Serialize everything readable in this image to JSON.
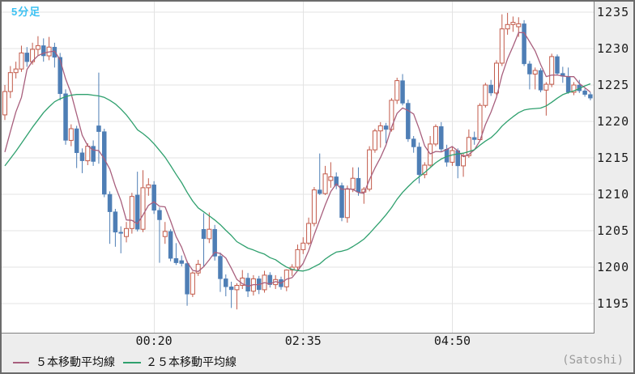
{
  "title": "5分足",
  "unit_label": "(Satoshi)",
  "colors": {
    "up": "#c25a4a",
    "down": "#4e7eb5",
    "ma5": "#a85f7d",
    "ma25": "#2fa06e",
    "title": "#3cc1f2",
    "grid": "#e3e3e3",
    "axis_text": "#1b1b1b",
    "muted_text": "#9a9a9a",
    "plot_border": "#808080",
    "frame": "#6b6b6b",
    "panel_bg": "#ededed",
    "plot_bg": "#ffffff"
  },
  "y_axis": {
    "gridline_values": [
      1235,
      1230,
      1225,
      1220,
      1215,
      1210,
      1205,
      1200,
      1195
    ]
  },
  "x_axis": {
    "ticks": [
      {
        "label": "00:20",
        "bar": 27
      },
      {
        "label": "02:35",
        "bar": 54
      },
      {
        "label": "04:50",
        "bar": 81
      }
    ]
  },
  "legend": [
    {
      "label": "５本移動平均線",
      "series": "ma5"
    },
    {
      "label": "２５本移動平均線",
      "series": "ma25"
    }
  ],
  "chart_data": {
    "type": "candlestick",
    "interval": "5min",
    "title": "5分足",
    "unit": "Satoshi",
    "ylim": [
      1191.5,
      1236.5
    ],
    "grid_step": 5,
    "candle_format": [
      "open",
      "high",
      "low",
      "close",
      "up"
    ],
    "candles": [
      [
        1220.9,
        1225.0,
        1220.2,
        1224.1,
        1
      ],
      [
        1224.1,
        1227.6,
        1223.2,
        1226.7,
        1
      ],
      [
        1226.7,
        1228.2,
        1225.9,
        1227.2,
        1
      ],
      [
        1227.2,
        1230.4,
        1226.8,
        1229.4,
        1
      ],
      [
        1229.4,
        1230.2,
        1227.5,
        1228.2,
        0
      ],
      [
        1228.2,
        1230.8,
        1227.8,
        1229.9,
        1
      ],
      [
        1229.9,
        1231.7,
        1229.0,
        1230.4,
        1
      ],
      [
        1230.4,
        1231.4,
        1228.2,
        1229.0,
        0
      ],
      [
        1229.0,
        1231.6,
        1228.4,
        1230.2,
        1
      ],
      [
        1230.2,
        1230.8,
        1227.4,
        1228.8,
        0
      ],
      [
        1228.8,
        1229.4,
        1222.9,
        1223.8,
        0
      ],
      [
        1223.8,
        1224.4,
        1216.8,
        1217.4,
        0
      ],
      [
        1217.4,
        1219.6,
        1216.6,
        1219.0,
        1
      ],
      [
        1219.0,
        1219.4,
        1213.6,
        1215.7,
        0
      ],
      [
        1215.7,
        1216.3,
        1212.9,
        1214.6,
        0
      ],
      [
        1214.6,
        1217.0,
        1214.0,
        1216.6,
        1
      ],
      [
        1216.6,
        1217.4,
        1213.9,
        1214.5,
        0
      ],
      [
        1219.4,
        1226.7,
        1214.2,
        1218.6,
        0
      ],
      [
        1218.6,
        1219.0,
        1209.6,
        1210.0,
        0
      ],
      [
        1210.0,
        1210.4,
        1203.2,
        1207.6,
        0
      ],
      [
        1207.6,
        1208.0,
        1202.8,
        1204.8,
        0
      ],
      [
        1204.8,
        1205.6,
        1201.9,
        1204.7,
        0
      ],
      [
        1204.2,
        1206.2,
        1203.4,
        1205.3,
        1
      ],
      [
        1205.3,
        1210.2,
        1204.6,
        1209.7,
        1
      ],
      [
        1209.9,
        1213.1,
        1204.9,
        1205.2,
        0
      ],
      [
        1205.2,
        1213.3,
        1204.8,
        1210.9,
        1
      ],
      [
        1210.9,
        1212.2,
        1209.8,
        1211.3,
        1
      ],
      [
        1211.3,
        1211.8,
        1207.3,
        1207.8,
        0
      ],
      [
        1207.8,
        1208.2,
        1200.6,
        1206.5,
        0
      ],
      [
        1204.2,
        1206.2,
        1203.2,
        1204.9,
        1
      ],
      [
        1204.9,
        1205.2,
        1200.8,
        1201.2,
        0
      ],
      [
        1201.2,
        1203.3,
        1200.3,
        1200.6,
        0
      ],
      [
        1200.9,
        1201.6,
        1200.1,
        1200.5,
        0
      ],
      [
        1200.5,
        1200.9,
        1194.7,
        1196.3,
        0
      ],
      [
        1196.3,
        1199.4,
        1195.9,
        1199.2,
        1
      ],
      [
        1199.2,
        1201.0,
        1198.8,
        1200.4,
        1
      ],
      [
        1205.2,
        1207.4,
        1200.1,
        1203.9,
        0
      ],
      [
        1203.9,
        1207.5,
        1203.3,
        1205.2,
        1
      ],
      [
        1205.2,
        1205.8,
        1200.9,
        1201.5,
        0
      ],
      [
        1201.5,
        1202.0,
        1196.6,
        1198.4,
        0
      ],
      [
        1198.4,
        1199.0,
        1196.0,
        1197.3,
        0
      ],
      [
        1197.3,
        1198.0,
        1194.4,
        1196.9,
        0
      ],
      [
        1196.9,
        1197.8,
        1194.2,
        1197.5,
        1
      ],
      [
        1197.5,
        1199.6,
        1197.0,
        1198.5,
        1
      ],
      [
        1198.5,
        1199.2,
        1195.9,
        1196.7,
        0
      ],
      [
        1196.7,
        1198.9,
        1196.1,
        1198.4,
        1
      ],
      [
        1198.4,
        1198.8,
        1196.3,
        1196.9,
        0
      ],
      [
        1196.9,
        1199.5,
        1196.5,
        1198.9,
        1
      ],
      [
        1198.9,
        1199.3,
        1197.2,
        1197.6,
        0
      ],
      [
        1197.6,
        1198.9,
        1197.0,
        1198.3,
        1
      ],
      [
        1198.3,
        1198.7,
        1196.9,
        1197.3,
        0
      ],
      [
        1197.3,
        1199.7,
        1196.7,
        1199.6,
        1
      ],
      [
        1199.6,
        1200.4,
        1198.8,
        1200.0,
        1
      ],
      [
        1200.0,
        1203.1,
        1199.6,
        1202.4,
        1
      ],
      [
        1202.4,
        1204.1,
        1201.8,
        1203.3,
        1
      ],
      [
        1203.3,
        1206.8,
        1203.0,
        1206.0,
        1
      ],
      [
        1206.0,
        1211.0,
        1205.6,
        1210.6,
        1
      ],
      [
        1210.6,
        1215.6,
        1209.9,
        1210.1,
        0
      ],
      [
        1210.1,
        1213.9,
        1209.9,
        1212.8,
        1
      ],
      [
        1211.9,
        1214.4,
        1210.9,
        1212.4,
        1
      ],
      [
        1212.4,
        1213.0,
        1210.7,
        1211.2,
        0
      ],
      [
        1211.2,
        1211.6,
        1206.3,
        1206.8,
        0
      ],
      [
        1206.8,
        1211.2,
        1206.1,
        1210.7,
        1
      ],
      [
        1210.7,
        1213.7,
        1210.3,
        1212.2,
        1
      ],
      [
        1212.2,
        1213.7,
        1209.8,
        1210.3,
        0
      ],
      [
        1210.3,
        1211.0,
        1208.7,
        1210.7,
        1
      ],
      [
        1210.7,
        1216.6,
        1210.4,
        1216.1,
        1
      ],
      [
        1216.1,
        1219.0,
        1215.7,
        1218.7,
        1
      ],
      [
        1218.7,
        1219.9,
        1216.4,
        1219.4,
        1
      ],
      [
        1219.4,
        1219.8,
        1217.0,
        1218.9,
        0
      ],
      [
        1218.9,
        1223.2,
        1218.6,
        1222.9,
        1
      ],
      [
        1222.9,
        1226.0,
        1222.4,
        1225.6,
        1
      ],
      [
        1225.6,
        1226.5,
        1222.2,
        1222.5,
        0
      ],
      [
        1222.5,
        1223.0,
        1217.2,
        1217.6,
        0
      ],
      [
        1217.6,
        1218.0,
        1215.7,
        1216.5,
        0
      ],
      [
        1216.5,
        1217.1,
        1211.5,
        1212.7,
        0
      ],
      [
        1212.7,
        1214.4,
        1212.2,
        1214.0,
        1
      ],
      [
        1214.0,
        1218.0,
        1213.8,
        1216.9,
        1
      ],
      [
        1216.9,
        1219.6,
        1216.6,
        1219.3,
        1
      ],
      [
        1219.3,
        1219.9,
        1215.8,
        1216.2,
        0
      ],
      [
        1216.2,
        1216.8,
        1213.8,
        1214.4,
        0
      ],
      [
        1214.4,
        1216.6,
        1213.9,
        1216.0,
        1
      ],
      [
        1216.0,
        1216.3,
        1212.2,
        1213.9,
        0
      ],
      [
        1213.9,
        1215.6,
        1212.4,
        1215.3,
        1
      ],
      [
        1215.3,
        1218.9,
        1215.0,
        1217.8,
        1
      ],
      [
        1217.8,
        1218.6,
        1216.8,
        1217.5,
        0
      ],
      [
        1217.5,
        1222.5,
        1217.3,
        1222.2,
        1
      ],
      [
        1222.2,
        1225.3,
        1221.9,
        1225.0,
        1
      ],
      [
        1225.0,
        1225.7,
        1223.5,
        1223.9,
        0
      ],
      [
        1223.9,
        1228.4,
        1223.6,
        1228.0,
        1
      ],
      [
        1228.0,
        1234.7,
        1227.6,
        1232.7,
        1
      ],
      [
        1232.7,
        1234.9,
        1231.9,
        1233.3,
        1
      ],
      [
        1233.3,
        1234.4,
        1232.3,
        1233.6,
        1
      ],
      [
        1233.0,
        1234.3,
        1231.6,
        1233.4,
        1
      ],
      [
        1233.4,
        1233.9,
        1227.6,
        1227.9,
        0
      ],
      [
        1227.9,
        1228.3,
        1224.4,
        1226.5,
        0
      ],
      [
        1226.5,
        1227.4,
        1224.4,
        1227.0,
        1
      ],
      [
        1227.0,
        1227.3,
        1224.0,
        1224.3,
        0
      ],
      [
        1224.3,
        1225.4,
        1220.8,
        1225.1,
        1
      ],
      [
        1225.1,
        1229.3,
        1224.7,
        1228.9,
        1
      ],
      [
        1228.9,
        1229.2,
        1226.3,
        1226.6,
        0
      ],
      [
        1226.6,
        1227.5,
        1225.3,
        1226.2,
        0
      ],
      [
        1226.2,
        1227.4,
        1223.8,
        1224.0,
        0
      ],
      [
        1224.0,
        1225.4,
        1223.6,
        1225.0,
        1
      ],
      [
        1225.0,
        1225.7,
        1223.9,
        1224.2,
        0
      ],
      [
        1224.2,
        1224.5,
        1223.4,
        1223.7,
        0
      ],
      [
        1223.7,
        1224.0,
        1222.9,
        1223.2,
        0
      ]
    ],
    "ma5_name": "５本移動平均線",
    "ma25_name": "２５本移動平均線",
    "ma5_seed": [
      1215.8,
      1218.6,
      1221.3,
      1223.3
    ],
    "ma25_seed": [
      1213.9,
      1214.9,
      1215.9,
      1217.0,
      1218.1,
      1219.2,
      1220.2,
      1221.2,
      1222.0,
      1222.7,
      1223.1,
      1223.4,
      1223.6,
      1223.7,
      1223.7,
      1223.7,
      1223.6,
      1223.5,
      1223.3,
      1222.9,
      1222.4,
      1221.7,
      1220.9,
      1219.9
    ]
  }
}
